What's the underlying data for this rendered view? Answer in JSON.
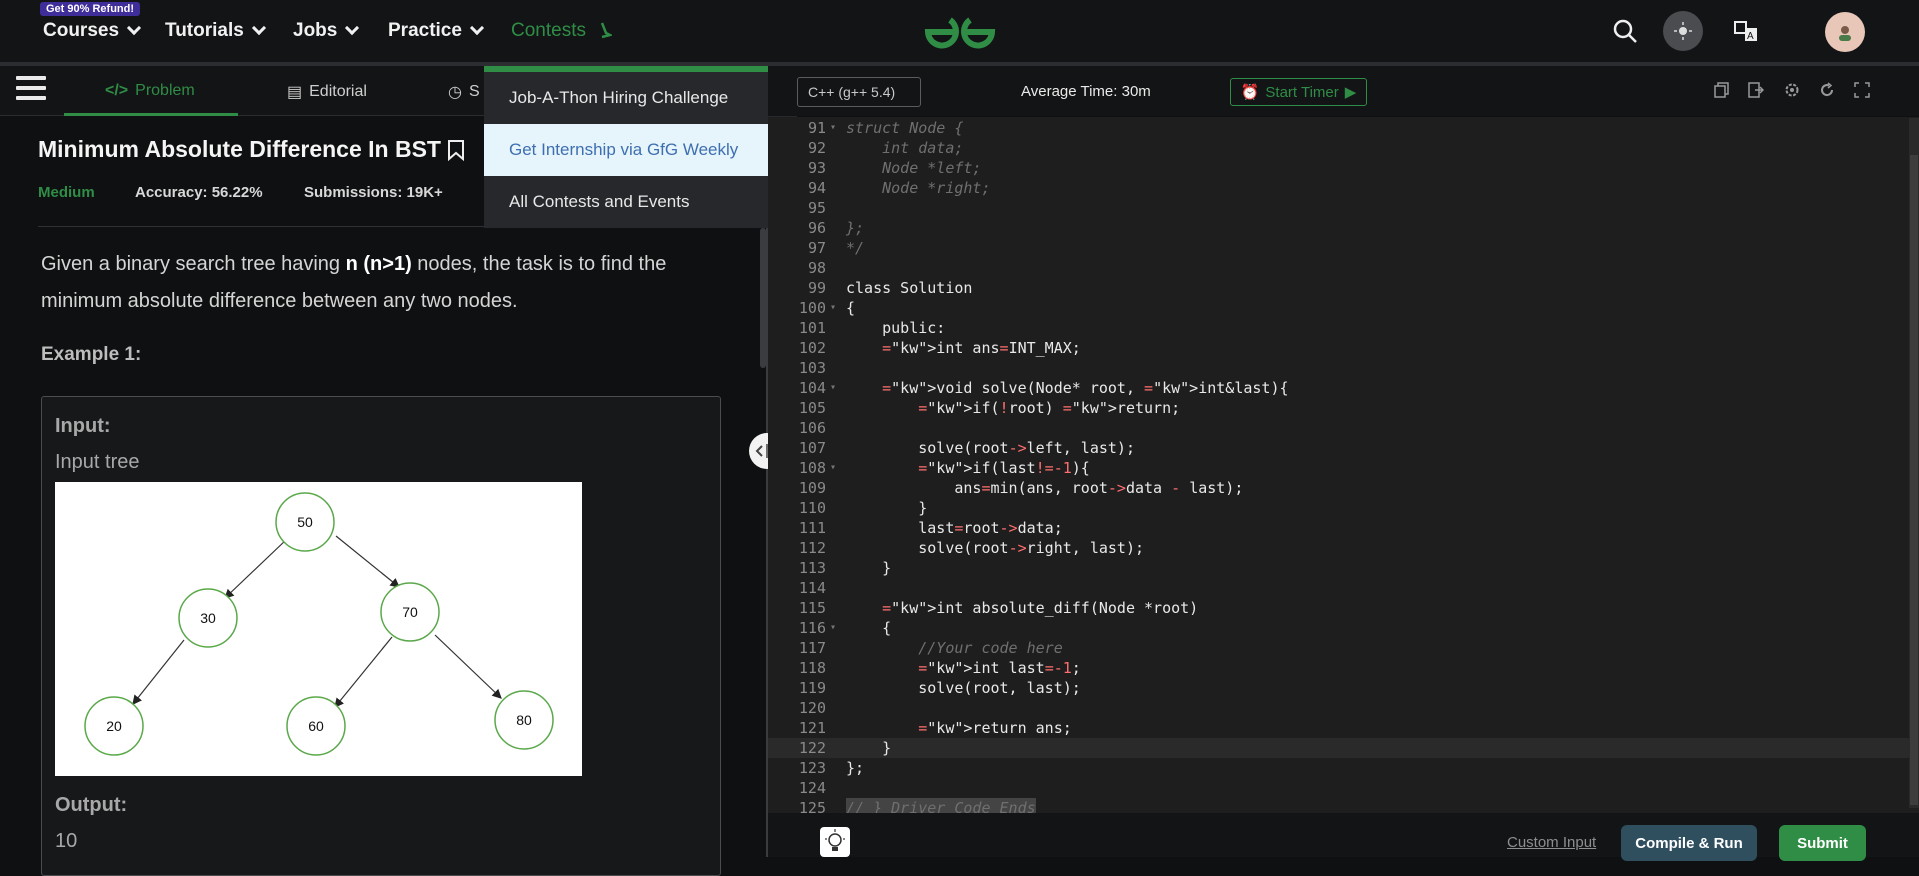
{
  "nav": {
    "items": [
      "Courses",
      "Tutorials",
      "Jobs",
      "Practice",
      "Contests"
    ],
    "refund_badge": "Get 90% Refund!"
  },
  "dropdown": {
    "items": [
      "Job-A-Thon Hiring Challenge",
      "Get Internship via GfG Weekly",
      "All Contests and Events"
    ],
    "active_index": 1
  },
  "tabs": {
    "problem": "Problem",
    "editorial": "Editorial",
    "submissions": "S"
  },
  "problem": {
    "title": "Minimum Absolute Difference In BST",
    "difficulty": "Medium",
    "accuracy": "Accuracy: 56.22%",
    "submissions": "Submissions: 19K+",
    "desc_pre": "Given a binary search tree having ",
    "desc_bold": "n (n>1)",
    "desc_post": " nodes, the task is to find the minimum absolute difference between any two nodes.",
    "example_title": "Example 1:",
    "input_label": "Input:",
    "input_text": "Input  tree",
    "output_label": "Output:",
    "output_value": "10"
  },
  "tree_nodes": [
    "50",
    "30",
    "70",
    "20",
    "60",
    "80"
  ],
  "editor": {
    "language": "C++ (g++ 5.4)",
    "avg_time": "Average Time: 30m",
    "timer_label": "Start Timer",
    "custom_input": "Custom Input",
    "compile_run": "Compile & Run",
    "submit": "Submit"
  },
  "code_lines": [
    {
      "n": "91",
      "t": "struct Node {",
      "c": "cm",
      "f": true
    },
    {
      "n": "92",
      "t": "    int data;",
      "c": "cm"
    },
    {
      "n": "93",
      "t": "    Node *left;",
      "c": "cm"
    },
    {
      "n": "94",
      "t": "    Node *right;",
      "c": "cm"
    },
    {
      "n": "95",
      "t": "",
      "c": ""
    },
    {
      "n": "96",
      "t": "};",
      "c": "cm"
    },
    {
      "n": "97",
      "t": "*/",
      "c": "cm"
    },
    {
      "n": "98",
      "t": "",
      "c": ""
    },
    {
      "n": "99",
      "t": "class Solution",
      "c": ""
    },
    {
      "n": "100",
      "t": "{",
      "c": "",
      "f": true
    },
    {
      "n": "101",
      "t": "    public:",
      "c": "",
      "k": "public"
    },
    {
      "n": "102",
      "t": "    int ans=INT_MAX;",
      "c": ""
    },
    {
      "n": "103",
      "t": "",
      "c": ""
    },
    {
      "n": "104",
      "t": "    void solve(Node* root, int&last){",
      "c": "",
      "f": true
    },
    {
      "n": "105",
      "t": "        if(!root) return;",
      "c": ""
    },
    {
      "n": "106",
      "t": "",
      "c": ""
    },
    {
      "n": "107",
      "t": "        solve(root->left, last);",
      "c": ""
    },
    {
      "n": "108",
      "t": "        if(last!=-1){",
      "c": "",
      "f": true
    },
    {
      "n": "109",
      "t": "            ans=min(ans, root->data - last);",
      "c": ""
    },
    {
      "n": "110",
      "t": "        }",
      "c": ""
    },
    {
      "n": "111",
      "t": "        last=root->data;",
      "c": ""
    },
    {
      "n": "112",
      "t": "        solve(root->right, last);",
      "c": ""
    },
    {
      "n": "113",
      "t": "    }",
      "c": ""
    },
    {
      "n": "114",
      "t": "",
      "c": ""
    },
    {
      "n": "115",
      "t": "    int absolute_diff(Node *root)",
      "c": ""
    },
    {
      "n": "116",
      "t": "    {",
      "c": "",
      "f": true
    },
    {
      "n": "117",
      "t": "        //Your code here",
      "c": "cm"
    },
    {
      "n": "118",
      "t": "        int last=-1;",
      "c": ""
    },
    {
      "n": "119",
      "t": "        solve(root, last);",
      "c": ""
    },
    {
      "n": "120",
      "t": "",
      "c": ""
    },
    {
      "n": "121",
      "t": "        return ans;",
      "c": ""
    },
    {
      "n": "122",
      "t": "    }",
      "c": "",
      "cur": true
    },
    {
      "n": "123",
      "t": "};",
      "c": ""
    },
    {
      "n": "124",
      "t": "",
      "c": ""
    },
    {
      "n": "125",
      "t": "// } Driver Code Ends",
      "c": "cm",
      "hl": true
    }
  ],
  "colors": {
    "brand_green": "#2f8d46",
    "badge_purple": "#3f2d99",
    "compile_bg": "#2f4f5f",
    "dropdown_active": "#e6f4fb"
  }
}
